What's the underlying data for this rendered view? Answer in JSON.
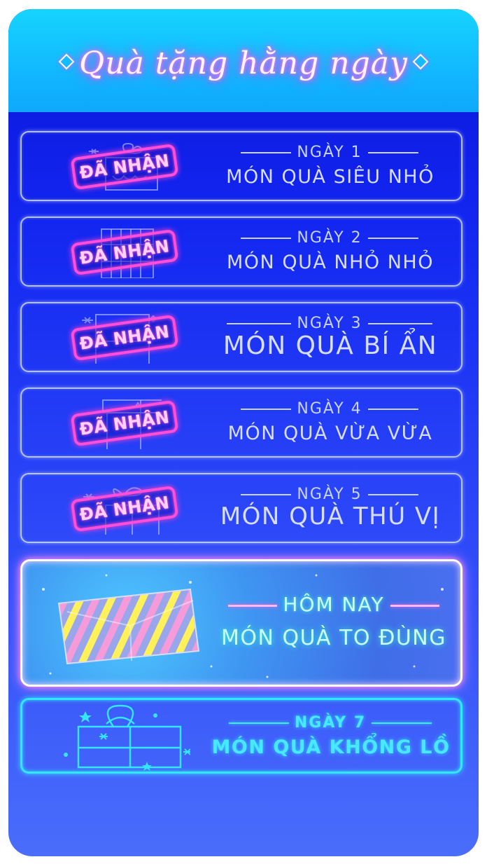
{
  "header": {
    "title": "Quà tặng hằng ngày"
  },
  "claimed_stamp_label": "ĐÃ NHẬN",
  "days": [
    {
      "day_label": "NGÀY 1",
      "gift_name": "MÓN QUÀ SIÊU NHỎ",
      "status": "claimed"
    },
    {
      "day_label": "NGÀY 2",
      "gift_name": "MÓN QUÀ NHỎ NHỎ",
      "status": "claimed"
    },
    {
      "day_label": "NGÀY 3",
      "gift_name": "MÓN QUÀ BÍ ẨN",
      "status": "claimed"
    },
    {
      "day_label": "NGÀY 4",
      "gift_name": "MÓN QUÀ VỪA VỪA",
      "status": "claimed"
    },
    {
      "day_label": "NGÀY 5",
      "gift_name": "MÓN QUÀ THÚ VỊ",
      "status": "claimed"
    }
  ],
  "today": {
    "day_label": "HÔM NAY",
    "gift_name": "MÓN QUÀ TO ĐÙNG",
    "status": "available"
  },
  "upcoming": {
    "day_label": "NGÀY 7",
    "gift_name": "MÓN QUÀ KHỔNG LỒ",
    "status": "locked"
  },
  "colors": {
    "claimed_stamp": "#ff4fd8",
    "today_glow": "#2ff6d0",
    "locked_glow": "#34e6ff",
    "background_top": "#0a14d8",
    "header": "#16d4ff"
  }
}
